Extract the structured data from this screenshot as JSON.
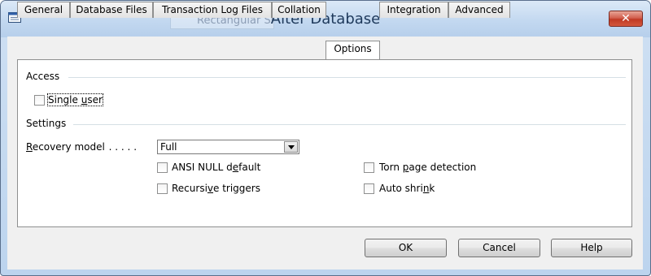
{
  "window": {
    "title": "Alter Database",
    "ghost_label": "Rectangular Snip",
    "close_glyph": "✕"
  },
  "tabs": [
    {
      "label": "General"
    },
    {
      "label": "Database Files"
    },
    {
      "label": "Transaction Log Files"
    },
    {
      "label": "Collation"
    },
    {
      "label": "Options",
      "active": true
    },
    {
      "label": "Integration"
    },
    {
      "label": "Advanced"
    }
  ],
  "access": {
    "group_label": "Access",
    "single_user": {
      "pre": "Single ",
      "u": "u",
      "post": "ser",
      "checked": false
    }
  },
  "settings": {
    "group_label": "Settings",
    "recovery": {
      "u": "R",
      "post": "ecovery model",
      "dots": ". . . . .",
      "value": "Full"
    },
    "ansi_null": {
      "pre": "ANSI NULL d",
      "u": "e",
      "post": "fault",
      "checked": false
    },
    "recursive": {
      "pre": "Recursi",
      "u": "v",
      "post": "e triggers",
      "checked": false
    },
    "torn_page": {
      "pre": "Torn ",
      "u": "p",
      "post": "age detection",
      "checked": false
    },
    "auto_shrink": {
      "pre": "Auto shri",
      "u": "n",
      "post": "k",
      "checked": false
    }
  },
  "buttons": {
    "ok": "OK",
    "cancel": "Cancel",
    "help": "Help"
  },
  "colors": {
    "title_text": "#1e395b",
    "close_button": "#c8462f",
    "frame": "#bcd4ee"
  }
}
